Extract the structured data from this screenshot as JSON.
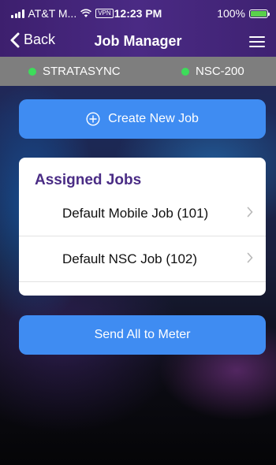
{
  "status_bar": {
    "carrier": "AT&T M...",
    "vpn": "VPN",
    "time": "12:23 PM",
    "battery": "100%",
    "battery_level": 1.0,
    "battery_color": "#5ad14b"
  },
  "nav": {
    "back_label": "Back",
    "title": "Job Manager"
  },
  "devices": [
    {
      "name": "STRATASYNC",
      "status_color": "#3ddc5a"
    },
    {
      "name": "NSC-200",
      "status_color": "#3ddc5a"
    }
  ],
  "create_button": {
    "label": "Create New Job",
    "icon": "plus-circle-icon"
  },
  "assigned": {
    "title": "Assigned Jobs",
    "jobs": [
      {
        "label": "Default Mobile Job (101)"
      },
      {
        "label": "Default NSC Job (102)"
      }
    ]
  },
  "send_button": {
    "label": "Send All to Meter"
  },
  "colors": {
    "accent": "#3f8cf2",
    "header_purple": "#4a2a84",
    "title_purple": "#4a2c85",
    "device_bar": "#7e7e7e"
  }
}
